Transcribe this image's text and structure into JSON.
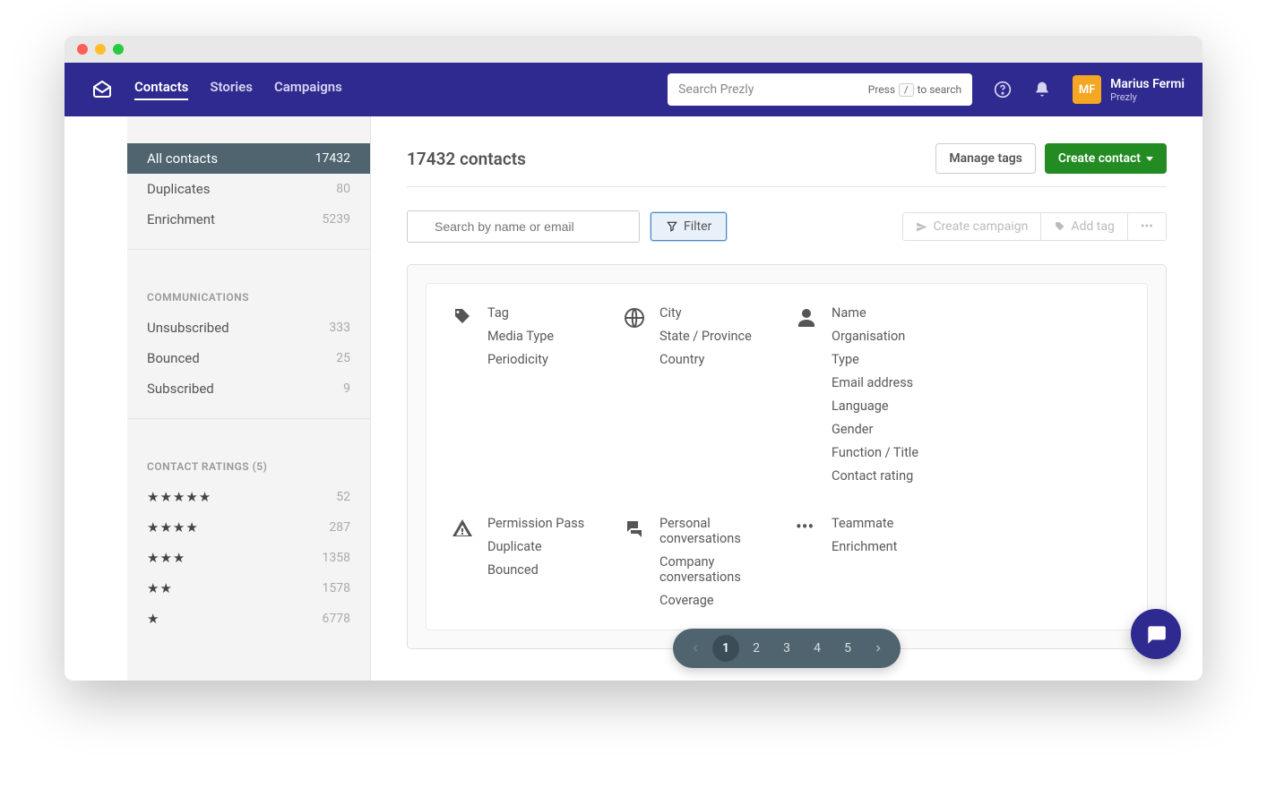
{
  "topnav": {
    "items": [
      "Contacts",
      "Stories",
      "Campaigns"
    ],
    "active": 0
  },
  "search": {
    "placeholder": "Search Prezly",
    "hint_prefix": "Press",
    "hint_key": "/",
    "hint_suffix": "to search"
  },
  "user": {
    "initials": "MF",
    "name": "Marius Fermi",
    "org": "Prezly"
  },
  "sidebar": {
    "primary": [
      {
        "label": "All contacts",
        "count": "17432",
        "active": true
      },
      {
        "label": "Duplicates",
        "count": "80"
      },
      {
        "label": "Enrichment",
        "count": "5239"
      }
    ],
    "communications_label": "COMMUNICATIONS",
    "communications": [
      {
        "label": "Unsubscribed",
        "count": "333"
      },
      {
        "label": "Bounced",
        "count": "25"
      },
      {
        "label": "Subscribed",
        "count": "9"
      }
    ],
    "ratings_label": "CONTACT RATINGS (5)",
    "ratings": [
      {
        "stars": "★★★★★",
        "count": "52"
      },
      {
        "stars": "★★★★",
        "count": "287"
      },
      {
        "stars": "★★★",
        "count": "1358"
      },
      {
        "stars": "★★",
        "count": "1578"
      },
      {
        "stars": "★",
        "count": "6778"
      }
    ]
  },
  "page": {
    "title": "17432 contacts",
    "manage_tags": "Manage tags",
    "create_contact": "Create contact"
  },
  "toolbar": {
    "search_placeholder": "Search by name or email",
    "filter_label": "Filter",
    "create_campaign": "Create campaign",
    "add_tag": "Add tag"
  },
  "filters": {
    "row1": [
      {
        "icon": "tag",
        "items": [
          "Tag",
          "Media Type",
          "Periodicity"
        ]
      },
      {
        "icon": "globe",
        "items": [
          "City",
          "State / Province",
          "Country"
        ]
      },
      {
        "icon": "person",
        "items": [
          "Name",
          "Organisation",
          "Type",
          "Email address",
          "Language",
          "Gender",
          "Function / Title",
          "Contact rating"
        ]
      },
      {
        "icon": "",
        "items": []
      }
    ],
    "row2": [
      {
        "icon": "warning",
        "items": [
          "Permission Pass",
          "Duplicate",
          "Bounced"
        ]
      },
      {
        "icon": "chat",
        "items": [
          "Personal conversations",
          "Company conversations",
          "Coverage"
        ]
      },
      {
        "icon": "dots",
        "items": [
          "Teammate",
          "Enrichment"
        ]
      },
      {
        "icon": "",
        "items": []
      }
    ]
  },
  "pagination": {
    "pages": [
      "1",
      "2",
      "3",
      "4",
      "5"
    ],
    "active": 0
  }
}
